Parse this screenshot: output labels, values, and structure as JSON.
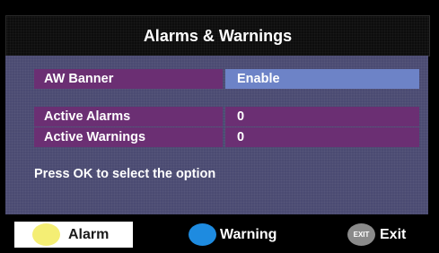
{
  "title": "Alarms & Warnings",
  "rows": {
    "banner": {
      "label": "AW Banner",
      "value": "Enable"
    },
    "alarms": {
      "label": "Active Alarms",
      "value": "0"
    },
    "warnings": {
      "label": "Active Warnings",
      "value": "0"
    }
  },
  "hint": "Press OK to select the option",
  "footer": {
    "alarm_label": "Alarm",
    "warning_label": "Warning",
    "exit_icon_text": "EXIT",
    "exit_label": "Exit"
  },
  "colors": {
    "panel": "#4b4b72",
    "row": "#6b2f73",
    "selected": "#6d83c7",
    "alarm": "#f4ee74",
    "warning": "#1e8be0",
    "exit": "#8a8a8a"
  }
}
